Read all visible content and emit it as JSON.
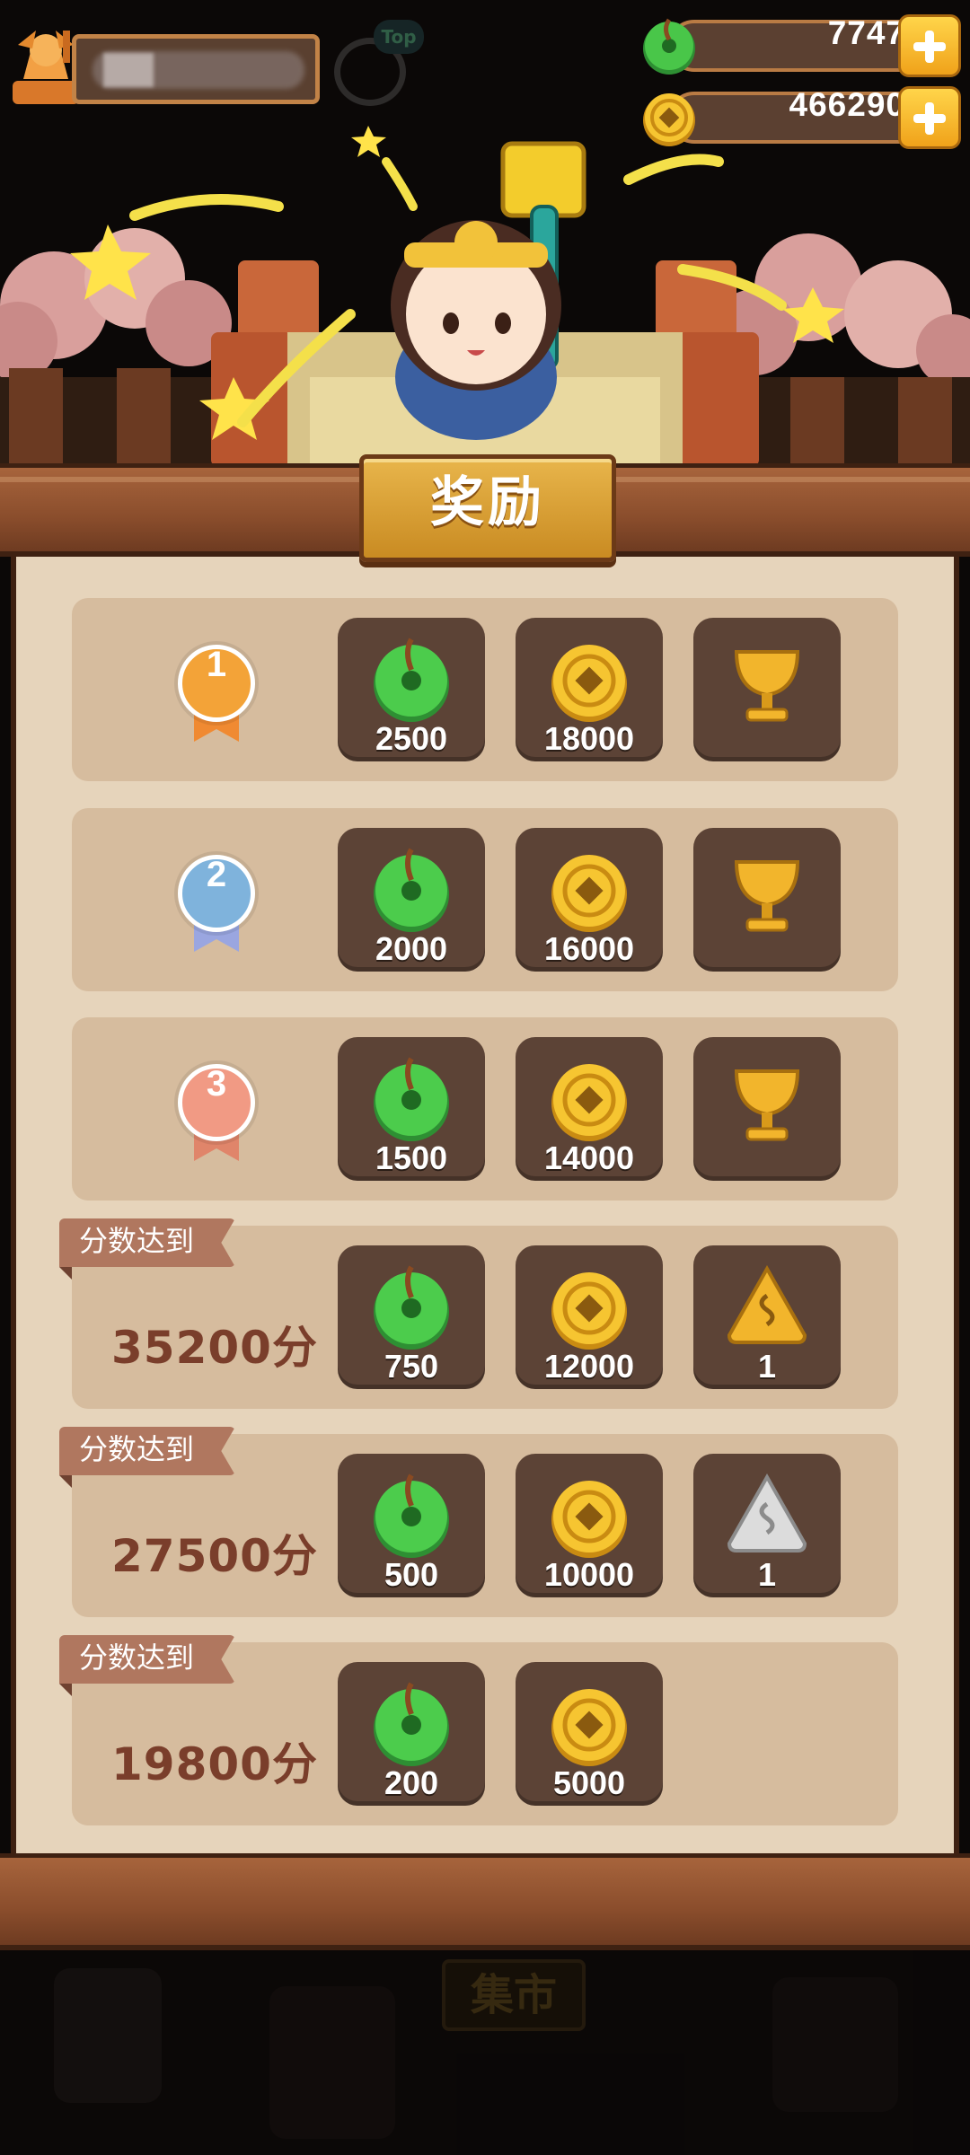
{
  "hud": {
    "jade": {
      "icon": "jade-coin-icon",
      "value": "7747"
    },
    "gold": {
      "icon": "gold-coin-icon",
      "value": "466290"
    }
  },
  "panel": {
    "title": "奖励",
    "score_tag": "分数达到",
    "rows": [
      {
        "rank": "1",
        "rewards": [
          {
            "icon": "jade-coin-icon",
            "amount": "2500"
          },
          {
            "icon": "gold-coin-icon",
            "amount": "18000"
          },
          {
            "icon": "gold-trophy-icon",
            "amount": ""
          }
        ]
      },
      {
        "rank": "2",
        "rewards": [
          {
            "icon": "jade-coin-icon",
            "amount": "2000"
          },
          {
            "icon": "gold-coin-icon",
            "amount": "16000"
          },
          {
            "icon": "gold-trophy-icon",
            "amount": ""
          }
        ]
      },
      {
        "rank": "3",
        "rewards": [
          {
            "icon": "jade-coin-icon",
            "amount": "1500"
          },
          {
            "icon": "gold-coin-icon",
            "amount": "14000"
          },
          {
            "icon": "gold-trophy-icon",
            "amount": ""
          }
        ]
      },
      {
        "score": "35200分",
        "rewards": [
          {
            "icon": "jade-coin-icon",
            "amount": "750"
          },
          {
            "icon": "gold-coin-icon",
            "amount": "12000"
          },
          {
            "icon": "gold-talisman-icon",
            "amount": "1"
          }
        ]
      },
      {
        "score": "27500分",
        "rewards": [
          {
            "icon": "jade-coin-icon",
            "amount": "500"
          },
          {
            "icon": "gold-coin-icon",
            "amount": "10000"
          },
          {
            "icon": "silver-talisman-icon",
            "amount": "1"
          }
        ]
      },
      {
        "score": "19800分",
        "rewards": [
          {
            "icon": "jade-coin-icon",
            "amount": "200"
          },
          {
            "icon": "gold-coin-icon",
            "amount": "5000"
          }
        ]
      }
    ]
  },
  "bottom_nav": {
    "market_label": "集市"
  },
  "colors": {
    "panel_bg": "#e6d4bb",
    "row_bg": "#d6bc9e",
    "slot_bg": "#5c4336",
    "wood": "#8a4d2c",
    "gold": "#e8b54b",
    "jade": "#3fc24a"
  }
}
